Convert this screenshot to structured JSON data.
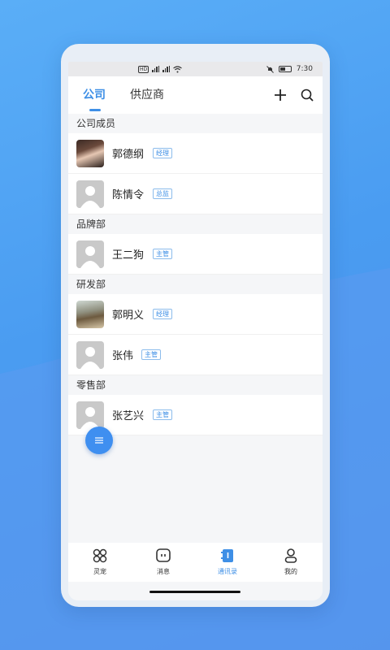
{
  "statusbar": {
    "time": "7:30",
    "network": "HD"
  },
  "header": {
    "tabs": [
      {
        "label": "公司",
        "active": true
      },
      {
        "label": "供应商",
        "active": false
      }
    ],
    "icons": [
      "plus-icon",
      "search-icon"
    ]
  },
  "sections": [
    {
      "title": "公司成员",
      "members": [
        {
          "name": "郭德纲",
          "role": "经理",
          "avatar": "photo"
        },
        {
          "name": "陈情令",
          "role": "总监",
          "avatar": "default"
        }
      ]
    },
    {
      "title": "品牌部",
      "members": [
        {
          "name": "王二狗",
          "role": "主管",
          "avatar": "default"
        }
      ]
    },
    {
      "title": "研发部",
      "members": [
        {
          "name": "郭明义",
          "role": "经理",
          "avatar": "photo"
        },
        {
          "name": "张伟",
          "role": "主管",
          "avatar": "default"
        }
      ]
    },
    {
      "title": "零售部",
      "members": [
        {
          "name": "张艺兴",
          "role": "主管",
          "avatar": "default"
        }
      ]
    }
  ],
  "tabbar": {
    "items": [
      {
        "label": "灵宠",
        "icon": "grid-icon",
        "active": false
      },
      {
        "label": "消息",
        "icon": "message-icon",
        "active": false
      },
      {
        "label": "通讯录",
        "icon": "contacts-icon",
        "active": true
      },
      {
        "label": "我的",
        "icon": "user-icon",
        "active": false
      }
    ]
  },
  "colors": {
    "accent": "#3e8fe6",
    "background": "#4a9cf1"
  }
}
